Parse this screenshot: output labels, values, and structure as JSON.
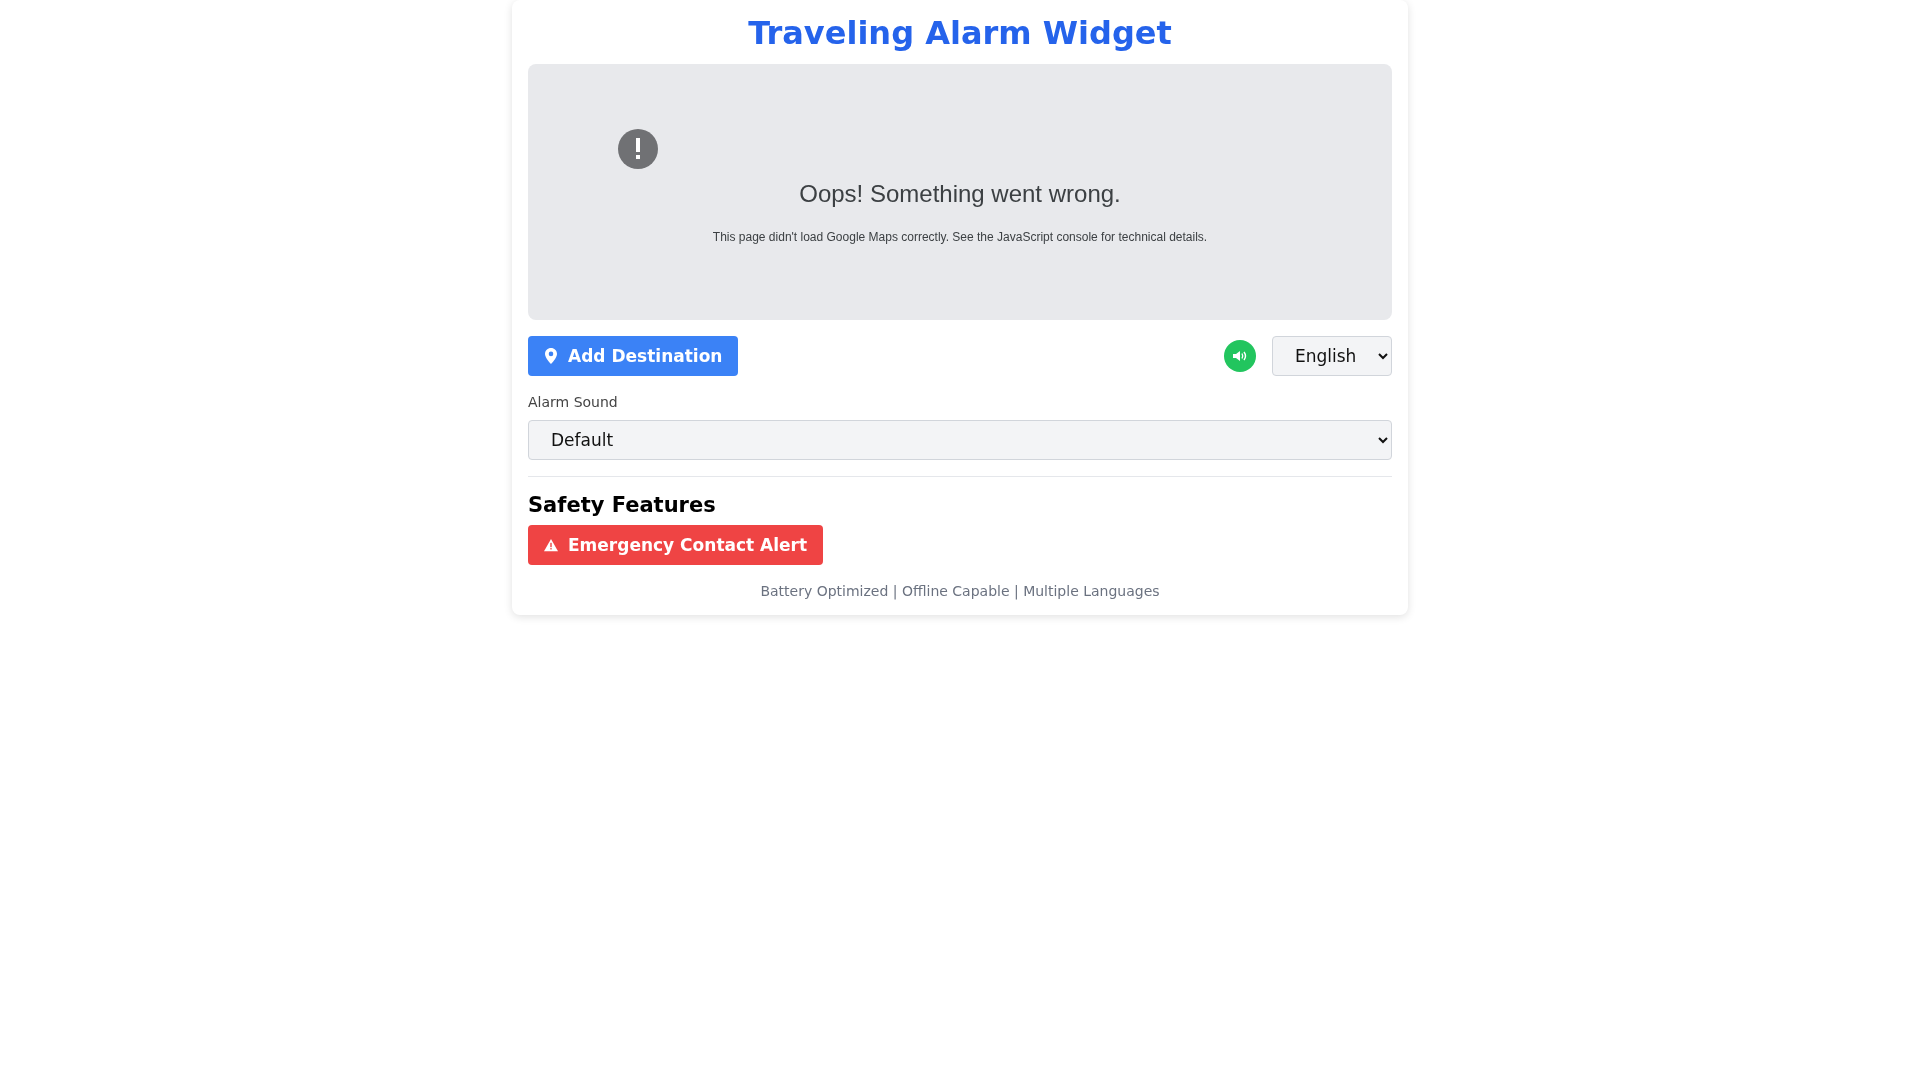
{
  "title": "Traveling Alarm Widget",
  "map_error": {
    "heading": "Oops! Something went wrong.",
    "message": "This page didn't load Google Maps correctly. See the JavaScript console for technical details."
  },
  "add_destination": {
    "label": "Add Destination"
  },
  "sound": {
    "on": true
  },
  "language": {
    "value": "English"
  },
  "alarm_sound": {
    "label": "Alarm Sound",
    "value": "Default"
  },
  "safety": {
    "heading": "Safety Features",
    "button": "Emergency Contact Alert"
  },
  "footer": "Battery Optimized | Offline Capable | Multiple Languages"
}
